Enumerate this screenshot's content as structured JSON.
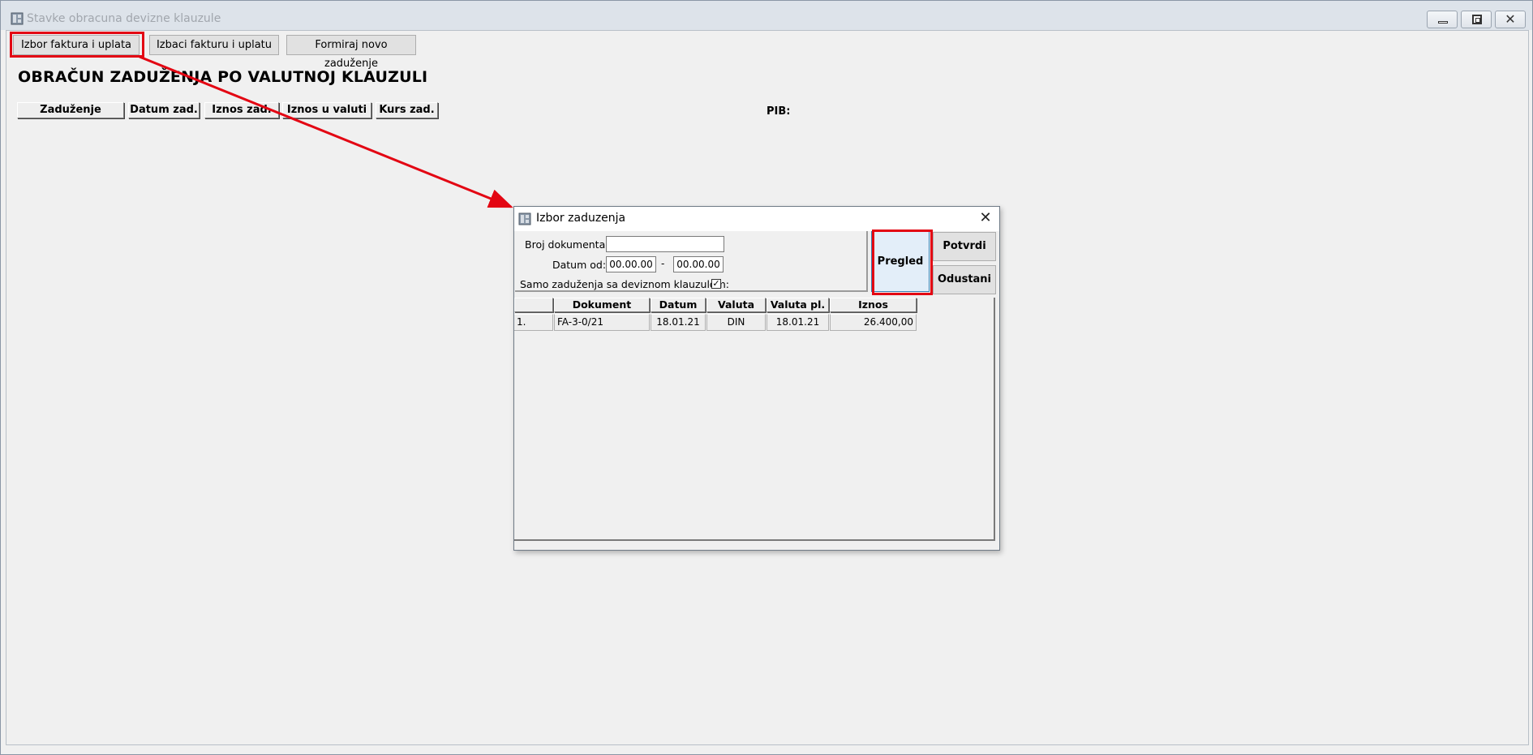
{
  "main_window": {
    "title": "Stavke obracuna devizne klauzule",
    "toolbar": {
      "izbor_label": "Izbor faktura i uplata",
      "izbaci_label": "Izbaci fakturu i uplatu",
      "formiraj_label": "Formiraj novo zaduženje"
    },
    "heading": "OBRAČUN ZADUŽENJA PO VALUTNOJ KLAUZULI",
    "columns": [
      "Zaduženje",
      "Datum zad.",
      "Iznos zad.",
      "Iznos u valuti",
      "Kurs zad."
    ],
    "pib_label": "PIB:"
  },
  "dialog": {
    "title": "Izbor zaduzenja",
    "broj_label": "Broj dokumenta:",
    "broj_value": "",
    "datum_label": "Datum od:",
    "datum_od": "00.00.00",
    "dash": "-",
    "datum_do": "00.00.00",
    "samo_label": "Samo zaduženja sa deviznom klauzulom:",
    "samo_checked": true,
    "pregled_label": "Pregled",
    "potvrdi_label": "Potvrdi",
    "odustani_label": "Odustani",
    "table": {
      "headers": [
        "",
        "Dokument",
        "Datum",
        "Valuta",
        "Valuta pl.",
        "Iznos"
      ],
      "rows": [
        [
          "1.",
          "FA-3-0/21",
          "18.01.21",
          "DIN",
          "18.01.21",
          "26.400,00"
        ]
      ]
    }
  },
  "annotation_color": "#e30613",
  "icons": {
    "window_icon": "app-icon",
    "close": "close-icon"
  }
}
